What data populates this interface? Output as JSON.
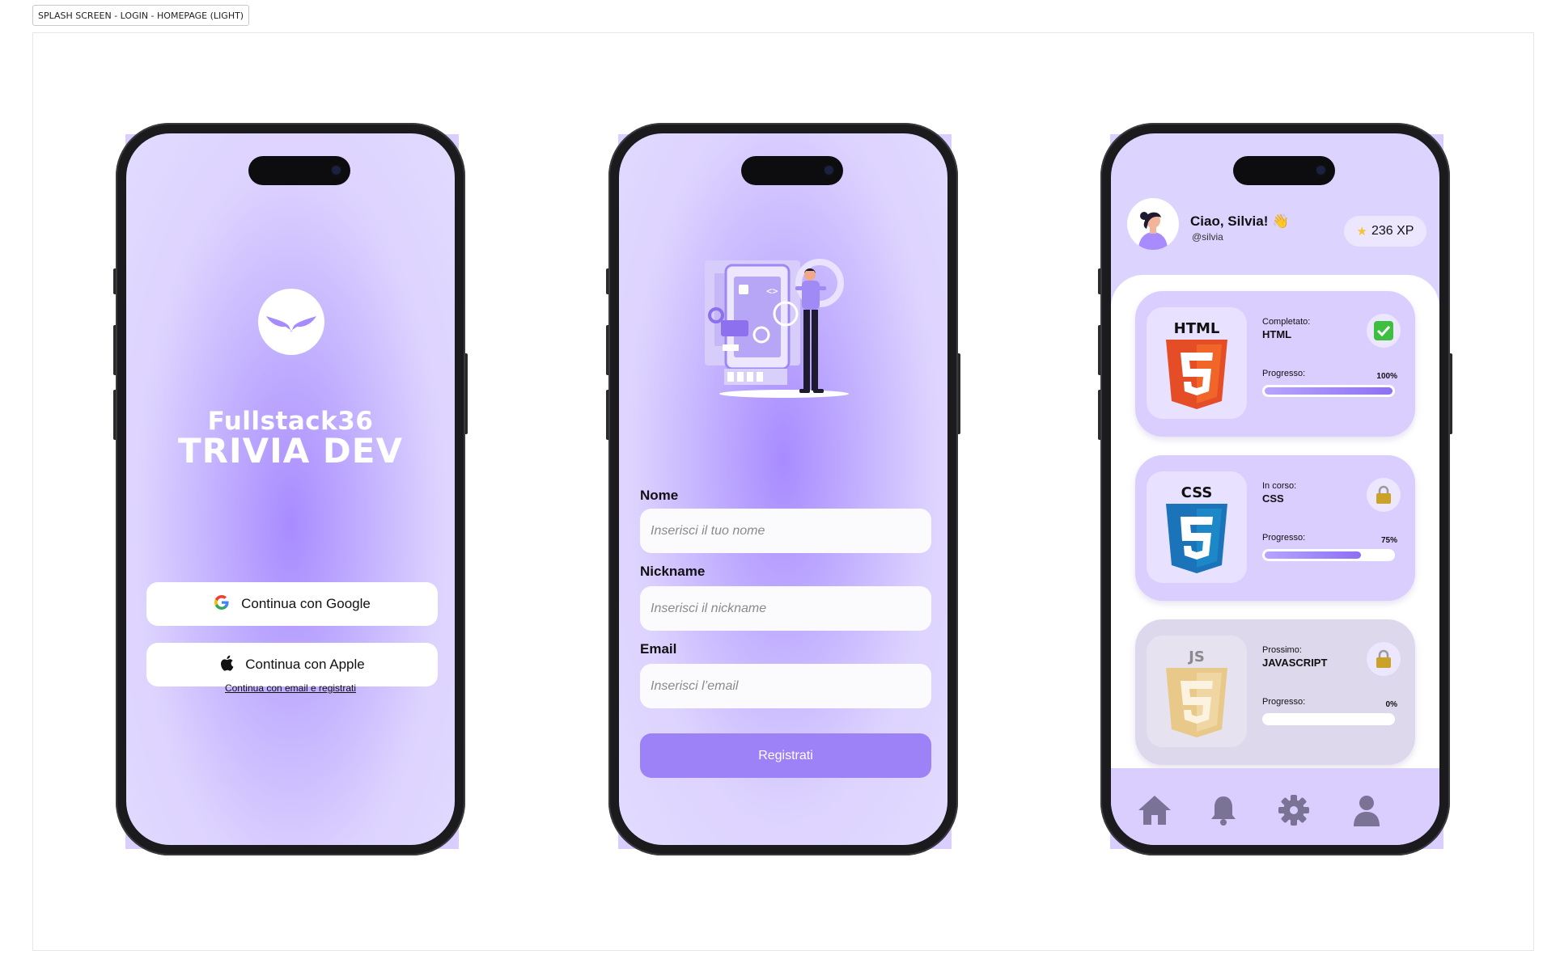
{
  "frame": {
    "label": "SPLASH SCREEN - LOGIN - HOMEPAGE (LIGHT)"
  },
  "splash": {
    "logo_icon": "wings-logo-icon",
    "brand_line1": "Fullstack36",
    "brand_line2": "TRIVIA DEV",
    "google_label": "Continua con Google",
    "apple_label": "Continua con Apple",
    "email_link": "Continua con email e registrati"
  },
  "login": {
    "illustration": "developer-app-illustration",
    "fields": [
      {
        "label": "Nome",
        "placeholder": "Inserisci il tuo nome"
      },
      {
        "label": "Nickname",
        "placeholder": "Inserisci il nickname"
      },
      {
        "label": "Email",
        "placeholder": "Inserisci l’email"
      }
    ],
    "submit_label": "Registrati"
  },
  "home": {
    "greeting": "Ciao, Silvia! 👋",
    "handle": "@silvia",
    "xp": "236 XP",
    "progress_label": "Progresso:",
    "courses": [
      {
        "status": "Completato:",
        "name": "HTML",
        "logo": "html5-logo-icon",
        "badge": "check-icon",
        "progress": 100,
        "progress_text": "100%",
        "color": "#e44d26"
      },
      {
        "status": "In corso:",
        "name": "CSS",
        "logo": "css3-logo-icon",
        "badge": "lock-icon",
        "progress": 75,
        "progress_text": "75%",
        "color": "#1b73ba"
      },
      {
        "status": "Prossimo:",
        "name": "JAVASCRIPT",
        "logo": "js-logo-icon",
        "badge": "lock-icon",
        "progress": 0,
        "progress_text": "0%",
        "color": "#e8c98a"
      }
    ],
    "tabs": [
      "home-icon",
      "bell-icon",
      "gear-icon",
      "user-icon"
    ]
  },
  "colors": {
    "accent": "#9d82f7",
    "lavender": "#ddd3ff",
    "icon_gray": "#7a7396"
  }
}
